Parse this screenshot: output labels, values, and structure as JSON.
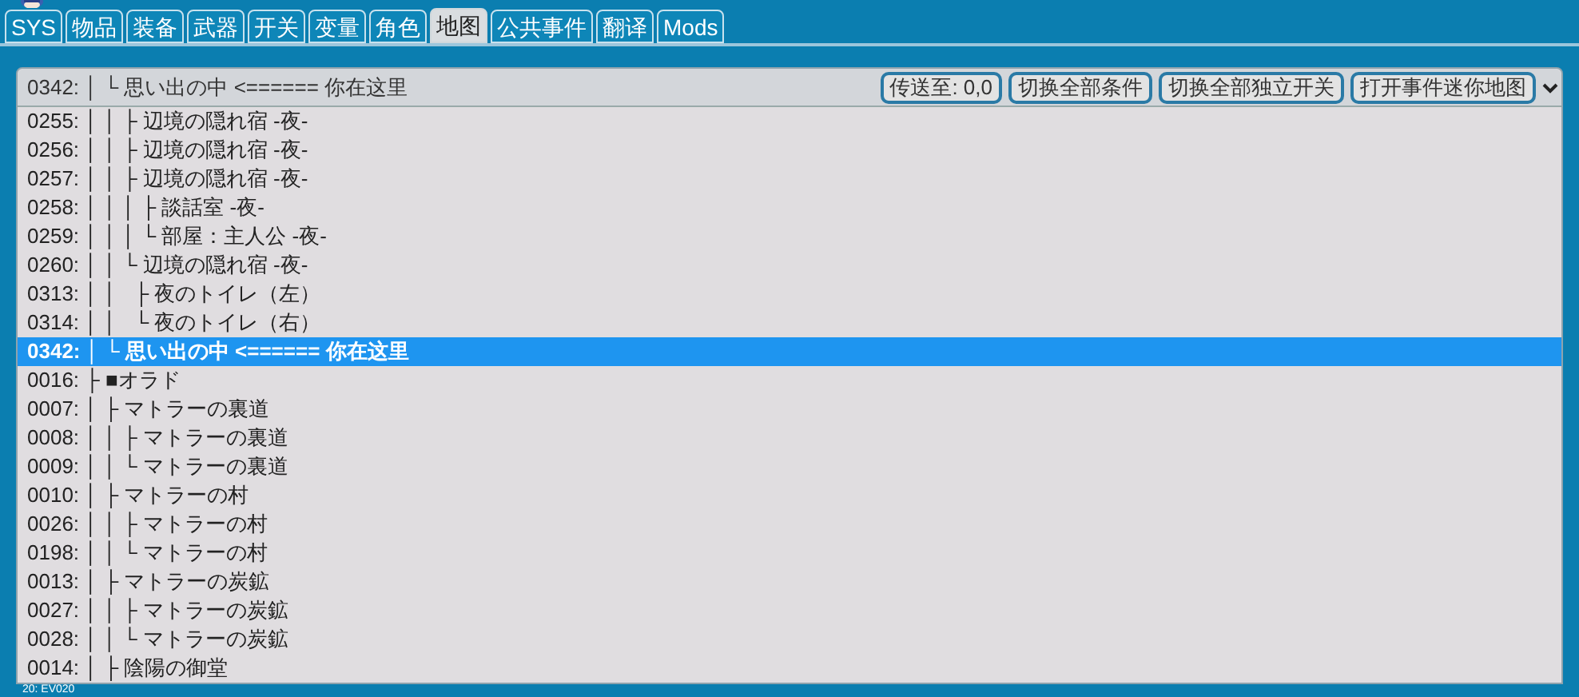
{
  "tabs": [
    {
      "label": "SYS",
      "selected": false
    },
    {
      "label": "物品",
      "selected": false
    },
    {
      "label": "装备",
      "selected": false
    },
    {
      "label": "武器",
      "selected": false
    },
    {
      "label": "开关",
      "selected": false
    },
    {
      "label": "变量",
      "selected": false
    },
    {
      "label": "角色",
      "selected": false
    },
    {
      "label": "地图",
      "selected": true
    },
    {
      "label": "公共事件",
      "selected": false
    },
    {
      "label": "翻译",
      "selected": false
    },
    {
      "label": "Mods",
      "selected": false
    }
  ],
  "map_select": {
    "value": "0342: │ └ 思い出の中 <====== 你在这里",
    "buttons": [
      "传送至: 0,0",
      "切换全部条件",
      "切换全部独立开关",
      "打开事件迷你地图"
    ]
  },
  "map_list": [
    {
      "id": "0255:",
      "text": "│ │ ├ 辺境の隠れ宿 -夜-",
      "selected": false
    },
    {
      "id": "0256:",
      "text": "│ │ ├ 辺境の隠れ宿 -夜-",
      "selected": false
    },
    {
      "id": "0257:",
      "text": "│ │ ├ 辺境の隠れ宿 -夜-",
      "selected": false
    },
    {
      "id": "0258:",
      "text": "│ │ │ ├ 談話室 -夜-",
      "selected": false
    },
    {
      "id": "0259:",
      "text": "│ │ │ └ 部屋：主人公 -夜-",
      "selected": false
    },
    {
      "id": "0260:",
      "text": "│ │ └ 辺境の隠れ宿 -夜-",
      "selected": false
    },
    {
      "id": "0313:",
      "text": "│ │   ├ 夜のトイレ（左）",
      "selected": false
    },
    {
      "id": "0314:",
      "text": "│ │   └ 夜のトイレ（右）",
      "selected": false
    },
    {
      "id": "0342:",
      "text": "│ └ 思い出の中 <====== 你在这里",
      "selected": true
    },
    {
      "id": "0016:",
      "text": "├ ■オラド",
      "selected": false
    },
    {
      "id": "0007:",
      "text": "│ ├ マトラーの裏道",
      "selected": false
    },
    {
      "id": "0008:",
      "text": "│ │ ├ マトラーの裏道",
      "selected": false
    },
    {
      "id": "0009:",
      "text": "│ │ └ マトラーの裏道",
      "selected": false
    },
    {
      "id": "0010:",
      "text": "│ ├ マトラーの村",
      "selected": false
    },
    {
      "id": "0026:",
      "text": "│ │ ├ マトラーの村",
      "selected": false
    },
    {
      "id": "0198:",
      "text": "│ │ └ マトラーの村",
      "selected": false
    },
    {
      "id": "0013:",
      "text": "│ ├ マトラーの炭鉱",
      "selected": false
    },
    {
      "id": "0027:",
      "text": "│ │ ├ マトラーの炭鉱",
      "selected": false
    },
    {
      "id": "0028:",
      "text": "│ │ └ マトラーの炭鉱",
      "selected": false
    },
    {
      "id": "0014:",
      "text": "│ ├ 陰陽の御堂",
      "selected": false
    }
  ],
  "status_text": "20: EV020"
}
